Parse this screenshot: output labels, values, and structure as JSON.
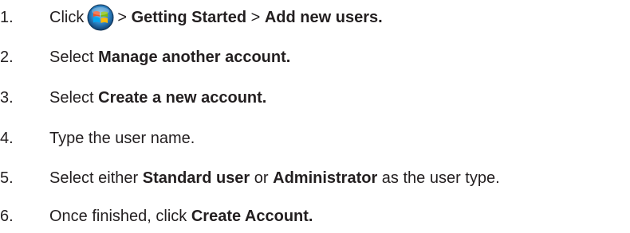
{
  "steps": [
    {
      "number": "1.",
      "parts": [
        {
          "text": "Click",
          "bold": false
        },
        {
          "icon": "windows-start-orb-icon"
        },
        {
          "text": "> ",
          "bold": false
        },
        {
          "text": "Getting Started",
          "bold": true
        },
        {
          "text": " > ",
          "bold": false
        },
        {
          "text": "Add new users.",
          "bold": true
        }
      ]
    },
    {
      "number": "2.",
      "parts": [
        {
          "text": "Select ",
          "bold": false
        },
        {
          "text": "Manage another account.",
          "bold": true
        }
      ]
    },
    {
      "number": "3.",
      "parts": [
        {
          "text": "Select ",
          "bold": false
        },
        {
          "text": "Create a new account.",
          "bold": true
        }
      ]
    },
    {
      "number": "4.",
      "parts": [
        {
          "text": "Type the user name.",
          "bold": false
        }
      ]
    },
    {
      "number": "5.",
      "parts": [
        {
          "text": "Select either ",
          "bold": false
        },
        {
          "text": "Standard user",
          "bold": true
        },
        {
          "text": " or ",
          "bold": false
        },
        {
          "text": "Administrator",
          "bold": true
        },
        {
          "text": " as the user type.",
          "bold": false
        }
      ]
    },
    {
      "number": "6.",
      "parts": [
        {
          "text": "Once finished, click ",
          "bold": false
        },
        {
          "text": "Create Account.",
          "bold": true
        }
      ]
    }
  ]
}
